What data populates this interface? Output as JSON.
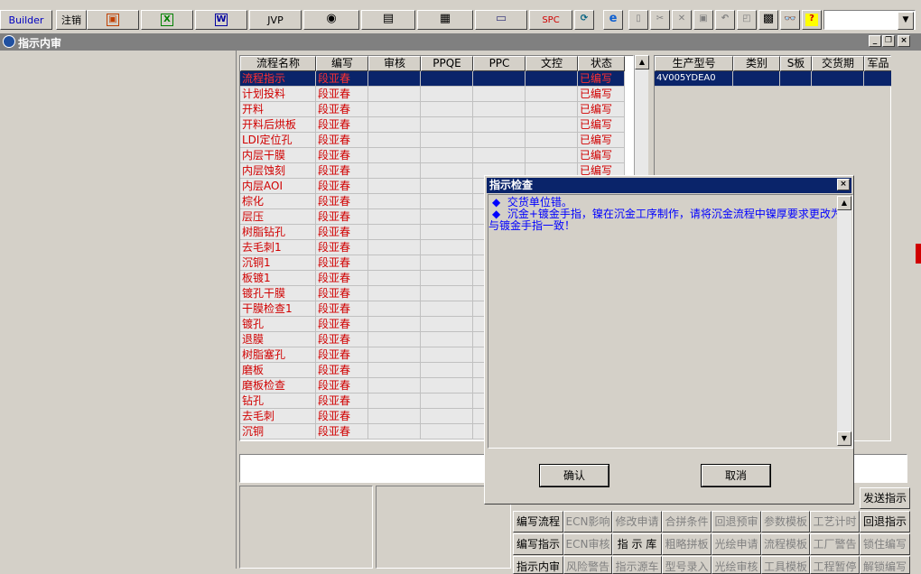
{
  "toolbar": {
    "builder": "Builder",
    "logout": "注销",
    "jvp": "JVP",
    "spc": "SPC",
    "icons": [
      "ppt-icon",
      "excel-icon",
      "word-icon",
      "jvp-button",
      "eye-icon",
      "database-icon",
      "network-icon",
      "printer-setup-icon",
      "spc-button",
      "refresh-icon",
      "ie-icon",
      "new-file-icon",
      "cut-icon",
      "delete-icon",
      "save-icon",
      "undo-icon",
      "preview-icon",
      "print-icon",
      "find-icon",
      "help-icon"
    ],
    "combo_value": ""
  },
  "window": {
    "title": "指示内审"
  },
  "flow_table": {
    "columns": [
      "流程名称",
      "编写",
      "审核",
      "PPQE",
      "PPC",
      "文控",
      "状态"
    ],
    "rows": [
      {
        "name": "流程指示",
        "writer": "段亚春",
        "status": "已编写"
      },
      {
        "name": "计划投料",
        "writer": "段亚春",
        "status": "已编写"
      },
      {
        "name": "开料",
        "writer": "段亚春",
        "status": "已编写"
      },
      {
        "name": "开料后烘板",
        "writer": "段亚春",
        "status": "已编写"
      },
      {
        "name": "LDI定位孔",
        "writer": "段亚春",
        "status": "已编写"
      },
      {
        "name": "内层干膜",
        "writer": "段亚春",
        "status": "已编写"
      },
      {
        "name": "内层蚀刻",
        "writer": "段亚春",
        "status": "已编写"
      },
      {
        "name": "内层AOI",
        "writer": "段亚春",
        "status": ""
      },
      {
        "name": "棕化",
        "writer": "段亚春",
        "status": ""
      },
      {
        "name": "层压",
        "writer": "段亚春",
        "status": ""
      },
      {
        "name": "树脂钻孔",
        "writer": "段亚春",
        "status": ""
      },
      {
        "name": "去毛刺1",
        "writer": "段亚春",
        "status": ""
      },
      {
        "name": "沉铜1",
        "writer": "段亚春",
        "status": ""
      },
      {
        "name": "板镀1",
        "writer": "段亚春",
        "status": ""
      },
      {
        "name": "镀孔干膜",
        "writer": "段亚春",
        "status": ""
      },
      {
        "name": "干膜检查1",
        "writer": "段亚春",
        "status": ""
      },
      {
        "name": "镀孔",
        "writer": "段亚春",
        "status": ""
      },
      {
        "name": "退膜",
        "writer": "段亚春",
        "status": ""
      },
      {
        "name": "树脂塞孔",
        "writer": "段亚春",
        "status": ""
      },
      {
        "name": "磨板",
        "writer": "段亚春",
        "status": ""
      },
      {
        "name": "磨板检查",
        "writer": "段亚春",
        "status": ""
      },
      {
        "name": "钻孔",
        "writer": "段亚春",
        "status": ""
      },
      {
        "name": "去毛刺",
        "writer": "段亚春",
        "status": ""
      },
      {
        "name": "沉铜",
        "writer": "段亚春",
        "status": ""
      }
    ]
  },
  "model_table": {
    "columns": [
      "生产型号",
      "类别",
      "S板",
      "交货期",
      "军品"
    ],
    "rows": [
      {
        "model": "4V005YDEA0"
      }
    ]
  },
  "dialog": {
    "title": "指示检查",
    "bullet": "◆",
    "messages": [
      "交货单位错。",
      "沉金+镀金手指，镍在沉金工序制作，请将沉金流程中镍厚要求更改为",
      "与镀金手指一致！"
    ],
    "ok": "确认",
    "cancel": "取消"
  },
  "bottom_buttons": {
    "row1": [
      {
        "label": "编写流程",
        "enabled": true
      },
      {
        "label": "ECN影响",
        "enabled": false
      },
      {
        "label": "修改申请",
        "enabled": false
      },
      {
        "label": "合拼条件",
        "enabled": false
      },
      {
        "label": "回退预审",
        "enabled": false
      },
      {
        "label": "参数模板",
        "enabled": false
      },
      {
        "label": "工艺计时",
        "enabled": false
      },
      {
        "label": "回退指示",
        "enabled": true
      }
    ],
    "row2": [
      {
        "label": "编写指示",
        "enabled": true
      },
      {
        "label": "ECN审核",
        "enabled": false
      },
      {
        "label": "指 示 库",
        "enabled": true
      },
      {
        "label": "粗略拼板",
        "enabled": false
      },
      {
        "label": "光绘申请",
        "enabled": false
      },
      {
        "label": "流程模板",
        "enabled": false
      },
      {
        "label": "工厂警告",
        "enabled": false
      },
      {
        "label": "锁住编写",
        "enabled": false
      }
    ],
    "row3": [
      {
        "label": "指示内审",
        "enabled": true
      },
      {
        "label": "风险警告",
        "enabled": false
      },
      {
        "label": "指示源车",
        "enabled": false
      },
      {
        "label": "型号录入",
        "enabled": false
      },
      {
        "label": "光绘审核",
        "enabled": false
      },
      {
        "label": "工具模板",
        "enabled": false
      },
      {
        "label": "工程暂停",
        "enabled": false
      },
      {
        "label": "解锁编写",
        "enabled": false
      }
    ],
    "send": "发送指示"
  },
  "colors": {
    "face": "#d4d0c8",
    "title_active": "#0a246a",
    "title_inactive": "#808080",
    "flow_text": "#d00000",
    "message_text": "#0000ff"
  }
}
